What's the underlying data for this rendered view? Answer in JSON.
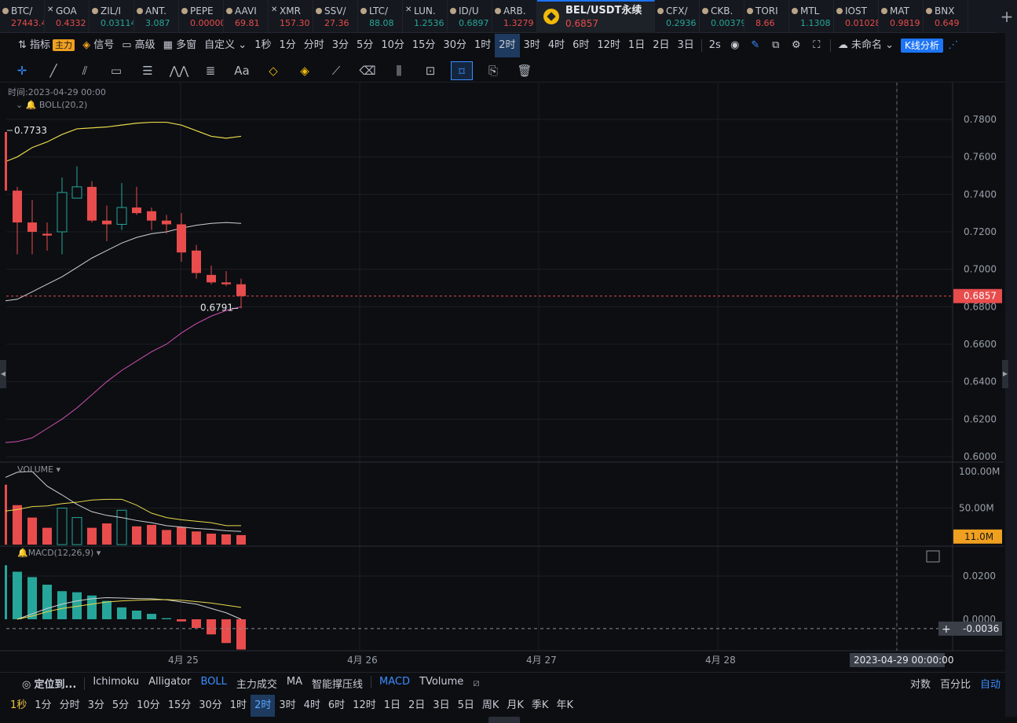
{
  "tickers": [
    {
      "symbol": "BTC/",
      "price": "27443.4",
      "dir": "down",
      "icon": "coin-icon"
    },
    {
      "symbol": "GOA",
      "price": "0.4332",
      "dir": "down",
      "icon": "x-icon"
    },
    {
      "symbol": "ZIL/I",
      "price": "0.03114",
      "dir": "up",
      "icon": "coin-icon"
    },
    {
      "symbol": "ANT.",
      "price": "3.087",
      "dir": "up",
      "icon": "coin-icon"
    },
    {
      "symbol": "PEPE",
      "price": "0.00000",
      "dir": "down",
      "icon": "coin-icon"
    },
    {
      "symbol": "AAVI",
      "price": "69.81",
      "dir": "down",
      "icon": "coin-icon"
    },
    {
      "symbol": "XMR",
      "price": "157.30",
      "dir": "down",
      "icon": "x-icon"
    },
    {
      "symbol": "SSV/",
      "price": "27.36",
      "dir": "down",
      "icon": "coin-icon"
    },
    {
      "symbol": "LTC/",
      "price": "88.08",
      "dir": "up",
      "icon": "coin-icon"
    },
    {
      "symbol": "LUN.",
      "price": "1.2536",
      "dir": "up",
      "icon": "x-icon"
    },
    {
      "symbol": "ID/U",
      "price": "0.6897",
      "dir": "up",
      "icon": "coin-icon"
    },
    {
      "symbol": "ARB.",
      "price": "1.3279",
      "dir": "down",
      "icon": "coin-icon"
    }
  ],
  "active_ticker": {
    "symbol": "BEL/USDT永续",
    "price": "0.6857"
  },
  "tickers_right": [
    {
      "symbol": "CFX/",
      "price": "0.2936",
      "dir": "up"
    },
    {
      "symbol": "CKB.",
      "price": "0.00379",
      "dir": "up"
    },
    {
      "symbol": "TORI",
      "price": "8.66",
      "dir": "down"
    },
    {
      "symbol": "MTL",
      "price": "1.1308",
      "dir": "up"
    },
    {
      "symbol": "IOST",
      "price": "0.01028",
      "dir": "down"
    },
    {
      "symbol": "MAT",
      "price": "0.9819",
      "dir": "down"
    },
    {
      "symbol": "BNX",
      "price": "0.649",
      "dir": "down"
    }
  ],
  "add_tab": "+",
  "toolbar": {
    "indicator": "指标",
    "main_badge": "主力",
    "signal": "信号",
    "advanced": "高级",
    "multi": "多窗",
    "custom": "自定义",
    "timeframes": [
      "1秒",
      "1分",
      "分时",
      "3分",
      "5分",
      "10分",
      "15分",
      "30分",
      "1时",
      "2时",
      "3时",
      "4时",
      "6时",
      "12时",
      "1日",
      "2日",
      "3日"
    ],
    "selected_tf": "1秒",
    "highlight_tf": "2时",
    "refresh": "2s",
    "layout_name": "未命名",
    "kline_btn": "K线分析"
  },
  "chart": {
    "time_label": "时间:2023-04-29 00:00",
    "boll_label": "BOLL(20,2)",
    "volume_label": "VOLUME",
    "macd_label": "MACD(12,26,9)",
    "price_axis": [
      "0.7800",
      "0.7600",
      "0.7400",
      "0.7200",
      "0.7000",
      "0.6800",
      "0.6600",
      "0.6400",
      "0.6200",
      "0.6000"
    ],
    "current_price": "0.6857",
    "high_mark": "0.7733",
    "low_mark": "0.6791",
    "volume_axis": [
      "100.00M",
      "50.00M"
    ],
    "volume_current": "11.0M",
    "macd_axis": [
      "0.0200",
      "0.0000"
    ],
    "macd_current": "-0.0036",
    "date_axis": [
      "4月 25",
      "4月 26",
      "4月 27",
      "4月 28"
    ],
    "crosshair_time": "2023-04-29 00:00:00",
    "colors": {
      "up": "#26a69a",
      "down": "#e84c4c",
      "boll_upper": "#e8d84a",
      "boll_mid": "#d0d0d0",
      "boll_lower": "#d050b0"
    }
  },
  "chart_data": {
    "type": "candlestick",
    "candles": [
      {
        "o": 0.742,
        "h": 0.744,
        "l": 0.708,
        "c": 0.725
      },
      {
        "o": 0.725,
        "h": 0.737,
        "l": 0.708,
        "c": 0.72
      },
      {
        "o": 0.719,
        "h": 0.725,
        "l": 0.71,
        "c": 0.718
      },
      {
        "o": 0.72,
        "h": 0.749,
        "l": 0.708,
        "c": 0.741
      },
      {
        "o": 0.738,
        "h": 0.755,
        "l": 0.738,
        "c": 0.744
      },
      {
        "o": 0.744,
        "h": 0.747,
        "l": 0.725,
        "c": 0.726
      },
      {
        "o": 0.726,
        "h": 0.734,
        "l": 0.715,
        "c": 0.724
      },
      {
        "o": 0.724,
        "h": 0.746,
        "l": 0.721,
        "c": 0.733
      },
      {
        "o": 0.733,
        "h": 0.744,
        "l": 0.729,
        "c": 0.73
      },
      {
        "o": 0.731,
        "h": 0.733,
        "l": 0.721,
        "c": 0.726
      },
      {
        "o": 0.726,
        "h": 0.729,
        "l": 0.719,
        "c": 0.724
      },
      {
        "o": 0.724,
        "h": 0.73,
        "l": 0.704,
        "c": 0.709
      },
      {
        "o": 0.71,
        "h": 0.713,
        "l": 0.695,
        "c": 0.698
      },
      {
        "o": 0.697,
        "h": 0.702,
        "l": 0.692,
        "c": 0.693
      },
      {
        "o": 0.693,
        "h": 0.699,
        "l": 0.691,
        "c": 0.692
      },
      {
        "o": 0.692,
        "h": 0.695,
        "l": 0.6791,
        "c": 0.6857
      }
    ],
    "boll_upper": [
      0.76,
      0.765,
      0.768,
      0.772,
      0.775,
      0.7755,
      0.776,
      0.777,
      0.778,
      0.7785,
      0.7785,
      0.777,
      0.774,
      0.771,
      0.77,
      0.771
    ],
    "boll_mid": [
      0.684,
      0.688,
      0.692,
      0.696,
      0.701,
      0.706,
      0.71,
      0.714,
      0.717,
      0.719,
      0.72,
      0.722,
      0.7235,
      0.7245,
      0.725,
      0.7245
    ],
    "boll_lower": [
      0.608,
      0.61,
      0.615,
      0.62,
      0.626,
      0.633,
      0.64,
      0.646,
      0.651,
      0.656,
      0.66,
      0.666,
      0.671,
      0.675,
      0.678,
      0.68
    ],
    "volume_M": [
      54,
      37,
      23,
      50,
      37,
      23,
      29,
      47,
      25,
      27,
      20,
      24,
      18,
      15,
      14,
      13
    ],
    "volume_ma_fast": [
      99,
      100,
      80,
      68,
      55,
      45,
      40,
      37,
      33,
      30,
      26,
      24,
      22,
      21,
      19,
      18
    ],
    "volume_ma_slow": [
      48,
      52,
      53,
      56,
      58,
      61,
      62,
      62,
      54,
      43,
      37,
      34,
      32,
      30,
      26,
      26
    ],
    "macd_hist": [
      0.022,
      0.0195,
      0.016,
      0.013,
      0.0125,
      0.011,
      0.0085,
      0.0055,
      0.004,
      0.0025,
      0.0005,
      -0.001,
      -0.004,
      -0.007,
      -0.011,
      -0.014
    ],
    "macd_dif": [
      0.0,
      0.0025,
      0.005,
      0.007,
      0.0085,
      0.0095,
      0.01,
      0.0098,
      0.0096,
      0.0095,
      0.009,
      0.008,
      0.007,
      0.005,
      0.003,
      0.0
    ],
    "macd_dea": [
      0.0,
      0.0015,
      0.0035,
      0.005,
      0.006,
      0.007,
      0.008,
      0.0085,
      0.0088,
      0.009,
      0.0091,
      0.0088,
      0.0082,
      0.0075,
      0.0065,
      0.0055
    ],
    "ylim": [
      0.6,
      0.78
    ]
  },
  "indicator_bar": {
    "locate": "定位到...",
    "items": [
      "Ichimoku",
      "Alligator",
      "BOLL",
      "主力成交",
      "MA",
      "智能撑压线",
      "MACD",
      "TVolume"
    ],
    "active": [
      "BOLL",
      "MACD"
    ],
    "right": [
      "对数",
      "百分比",
      "自动"
    ]
  },
  "bottom_timeframes": [
    "1秒",
    "1分",
    "分时",
    "3分",
    "5分",
    "10分",
    "15分",
    "30分",
    "1时",
    "2时",
    "3时",
    "4时",
    "6时",
    "12时",
    "1日",
    "2日",
    "3日",
    "5日",
    "周K",
    "月K",
    "季K",
    "年K"
  ]
}
